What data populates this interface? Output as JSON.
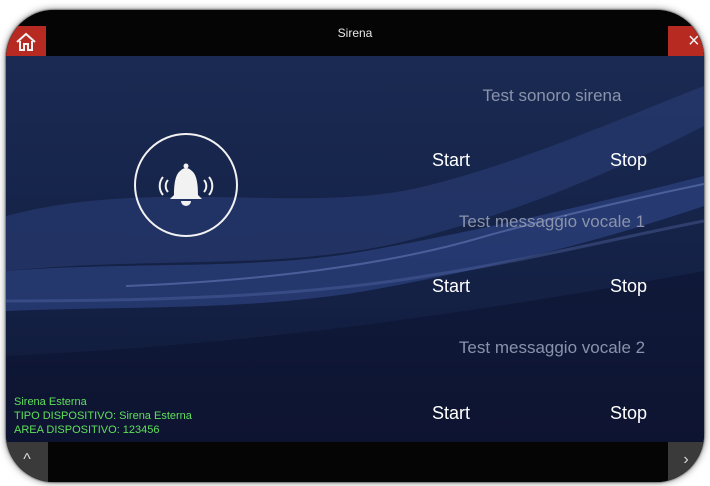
{
  "window": {
    "title": "Sirena"
  },
  "icons": {
    "home": "home-icon",
    "close": "close-icon",
    "bell": "bell-ringing-icon",
    "nav_left": "chevron-left-icon",
    "nav_right": "chevron-right-icon"
  },
  "header": {
    "close_glyph": "×"
  },
  "tests": [
    {
      "label": "Test sonoro sirena",
      "start": "Start",
      "stop": "Stop"
    },
    {
      "label": "Test messaggio vocale 1",
      "start": "Start",
      "stop": "Stop"
    },
    {
      "label": "Test messaggio vocale 2",
      "start": "Start",
      "stop": "Stop"
    }
  ],
  "device_info": {
    "name": "Sirena Esterna",
    "type_line": "TIPO DISPOSITIVO: Sirena Esterna",
    "area_line": "AREA DISPOSITIVO: 123456"
  },
  "bottom_nav": {
    "left_glyph": "^",
    "right_glyph": "›"
  },
  "colors": {
    "accent_red": "#b72a22",
    "info_green": "#5fe05a",
    "label_gray": "#8a93ab"
  }
}
